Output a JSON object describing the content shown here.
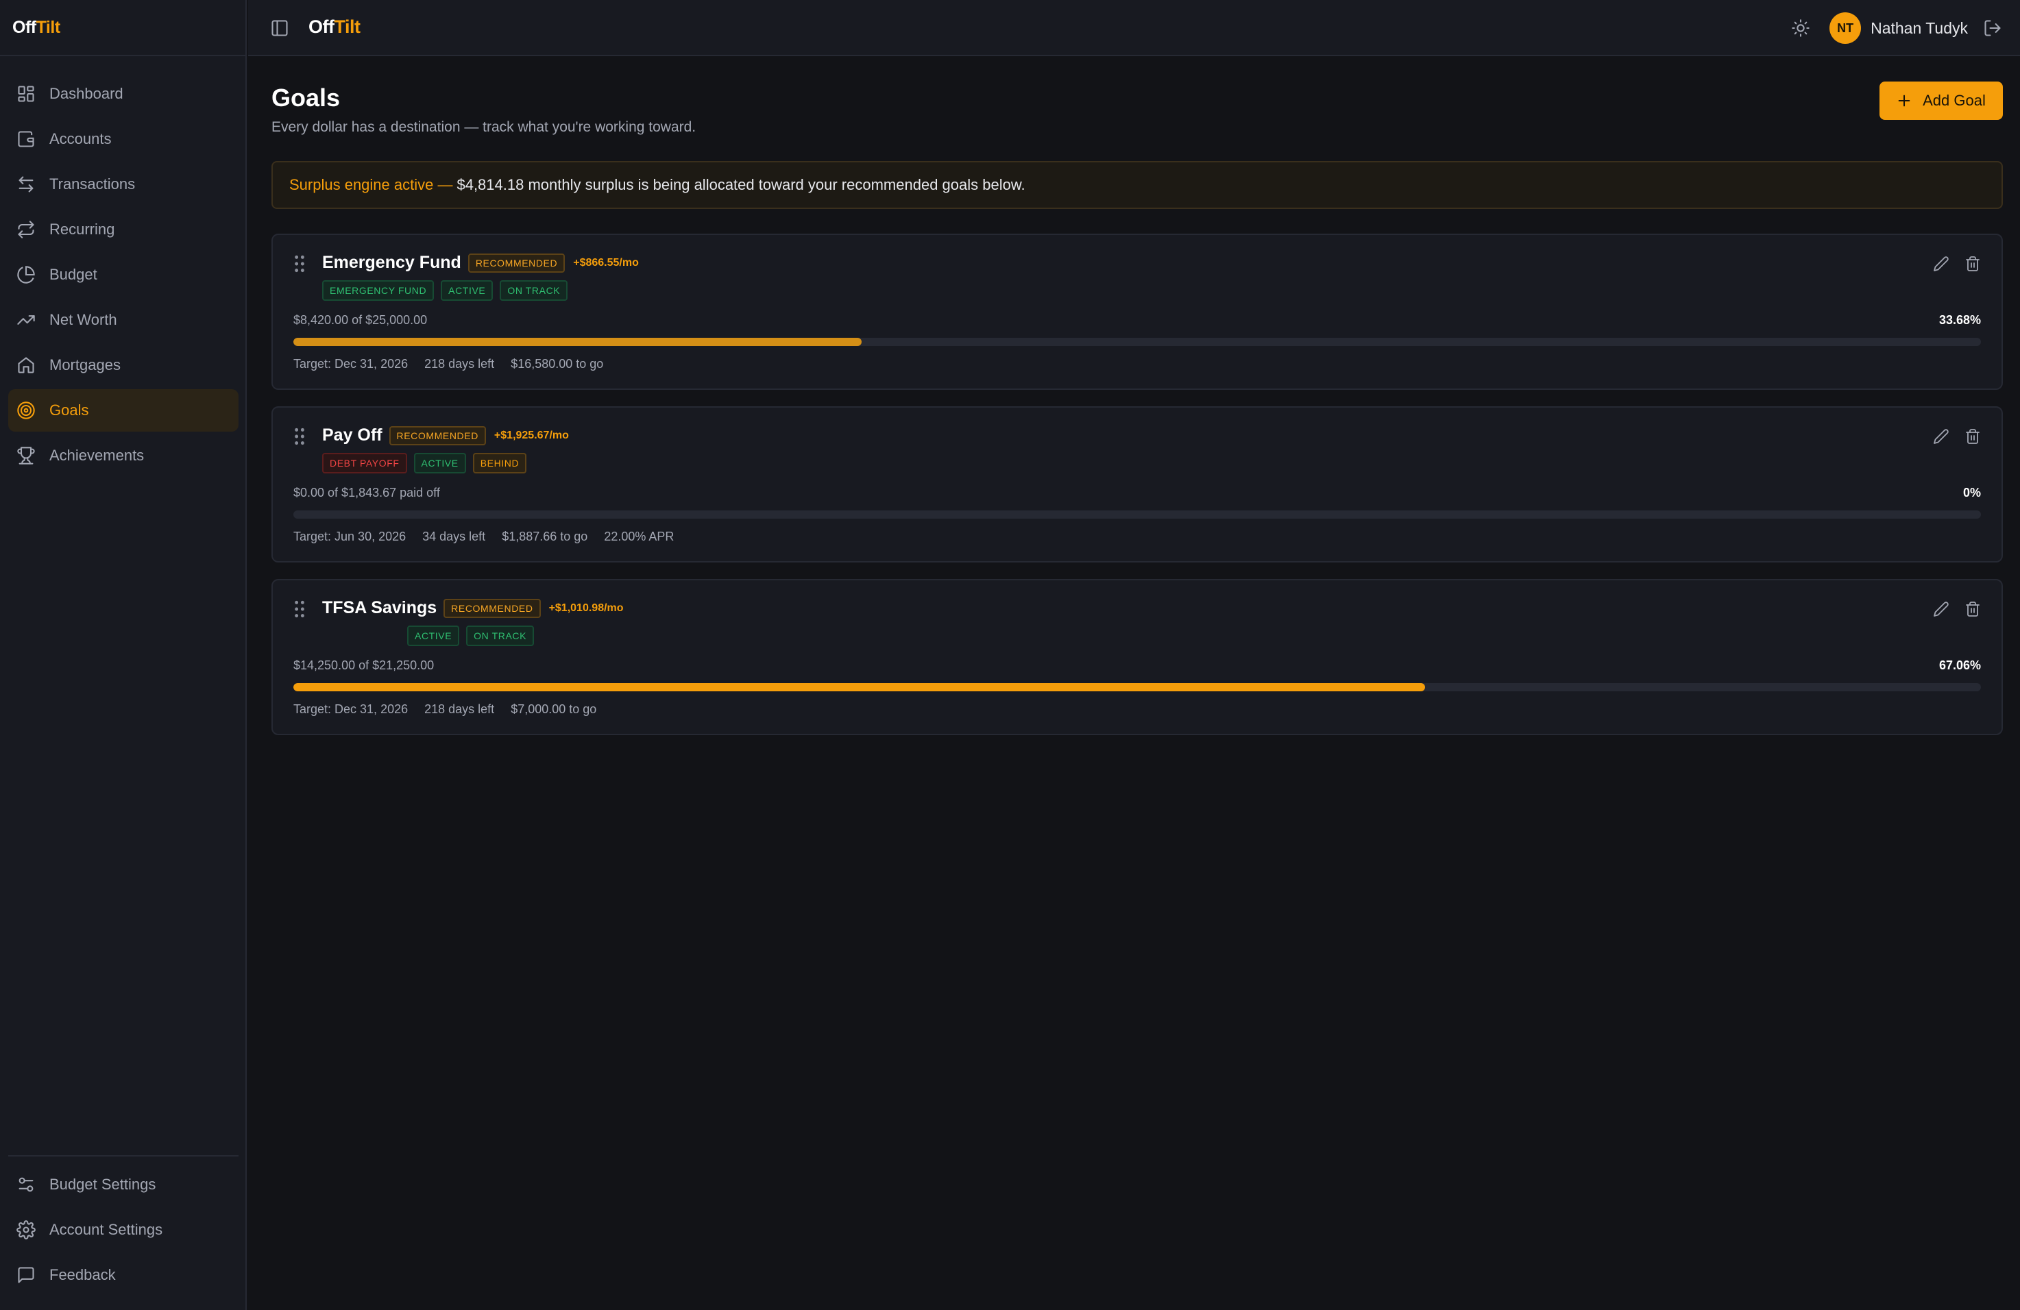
{
  "app": {
    "logo_off": "Off",
    "logo_tilt": "Tilt"
  },
  "sidebar": {
    "items": [
      {
        "label": "Dashboard",
        "icon": "dashboard-icon"
      },
      {
        "label": "Accounts",
        "icon": "wallet-icon"
      },
      {
        "label": "Transactions",
        "icon": "arrows-left-right-icon"
      },
      {
        "label": "Recurring",
        "icon": "repeat-icon"
      },
      {
        "label": "Budget",
        "icon": "pie-chart-icon"
      },
      {
        "label": "Net Worth",
        "icon": "trending-up-icon"
      },
      {
        "label": "Mortgages",
        "icon": "home-icon"
      },
      {
        "label": "Goals",
        "icon": "target-icon",
        "active": true
      },
      {
        "label": "Achievements",
        "icon": "trophy-icon"
      }
    ],
    "bottom_items": [
      {
        "label": "Budget Settings",
        "icon": "sliders-icon"
      },
      {
        "label": "Account Settings",
        "icon": "gear-icon"
      },
      {
        "label": "Feedback",
        "icon": "message-square-icon"
      }
    ]
  },
  "header": {
    "user_initials": "NT",
    "user_name": "Nathan Tudyk"
  },
  "page": {
    "title": "Goals",
    "subtitle": "Every dollar has a destination — track what you're working toward.",
    "add_button": "Add Goal"
  },
  "banner": {
    "highlight": "Surplus engine active —",
    "text": "$4,814.18 monthly surplus is being allocated toward your recommended goals below."
  },
  "colors": {
    "accent": "#f59e0b",
    "accent_dim": "#d48f16",
    "success": "#2fbf71",
    "danger": "#ef4444"
  },
  "goals": [
    {
      "title": "Emergency Fund",
      "recommended": "RECOMMENDED",
      "monthly": "+$866.55/mo",
      "tags": [
        {
          "label": "EMERGENCY FUND",
          "tone": "green"
        },
        {
          "label": "ACTIVE",
          "tone": "green"
        },
        {
          "label": "ON TRACK",
          "tone": "green"
        }
      ],
      "progress_label": "$8,420.00 of $25,000.00",
      "progress_pct": "33.68%",
      "progress_value": 0.3368,
      "bar_color": "#d48f16",
      "meta": [
        "Target: Dec 31, 2026",
        "218 days left",
        "$16,580.00 to go"
      ]
    },
    {
      "title": "Pay Off",
      "recommended": "RECOMMENDED",
      "monthly": "+$1,925.67/mo",
      "tags": [
        {
          "label": "DEBT PAYOFF",
          "tone": "red"
        },
        {
          "label": "ACTIVE",
          "tone": "green"
        },
        {
          "label": "BEHIND",
          "tone": "amber"
        }
      ],
      "progress_label": "$0.00 of $1,843.67 paid off",
      "progress_pct": "0%",
      "progress_value": 0,
      "bar_color": "#f59e0b",
      "meta": [
        "Target: Jun 30, 2026",
        "34 days left",
        "$1,887.66 to go",
        "22.00% APR"
      ]
    },
    {
      "title": "TFSA Savings",
      "recommended": "RECOMMENDED",
      "monthly": "+$1,010.98/mo",
      "tags": [
        {
          "label": "ACTIVE",
          "tone": "green"
        },
        {
          "label": "ON TRACK",
          "tone": "green"
        }
      ],
      "progress_label": "$14,250.00 of $21,250.00",
      "progress_pct": "67.06%",
      "progress_value": 0.6706,
      "bar_color": "#f59e0b",
      "meta": [
        "Target: Dec 31, 2026",
        "218 days left",
        "$7,000.00 to go"
      ]
    }
  ]
}
